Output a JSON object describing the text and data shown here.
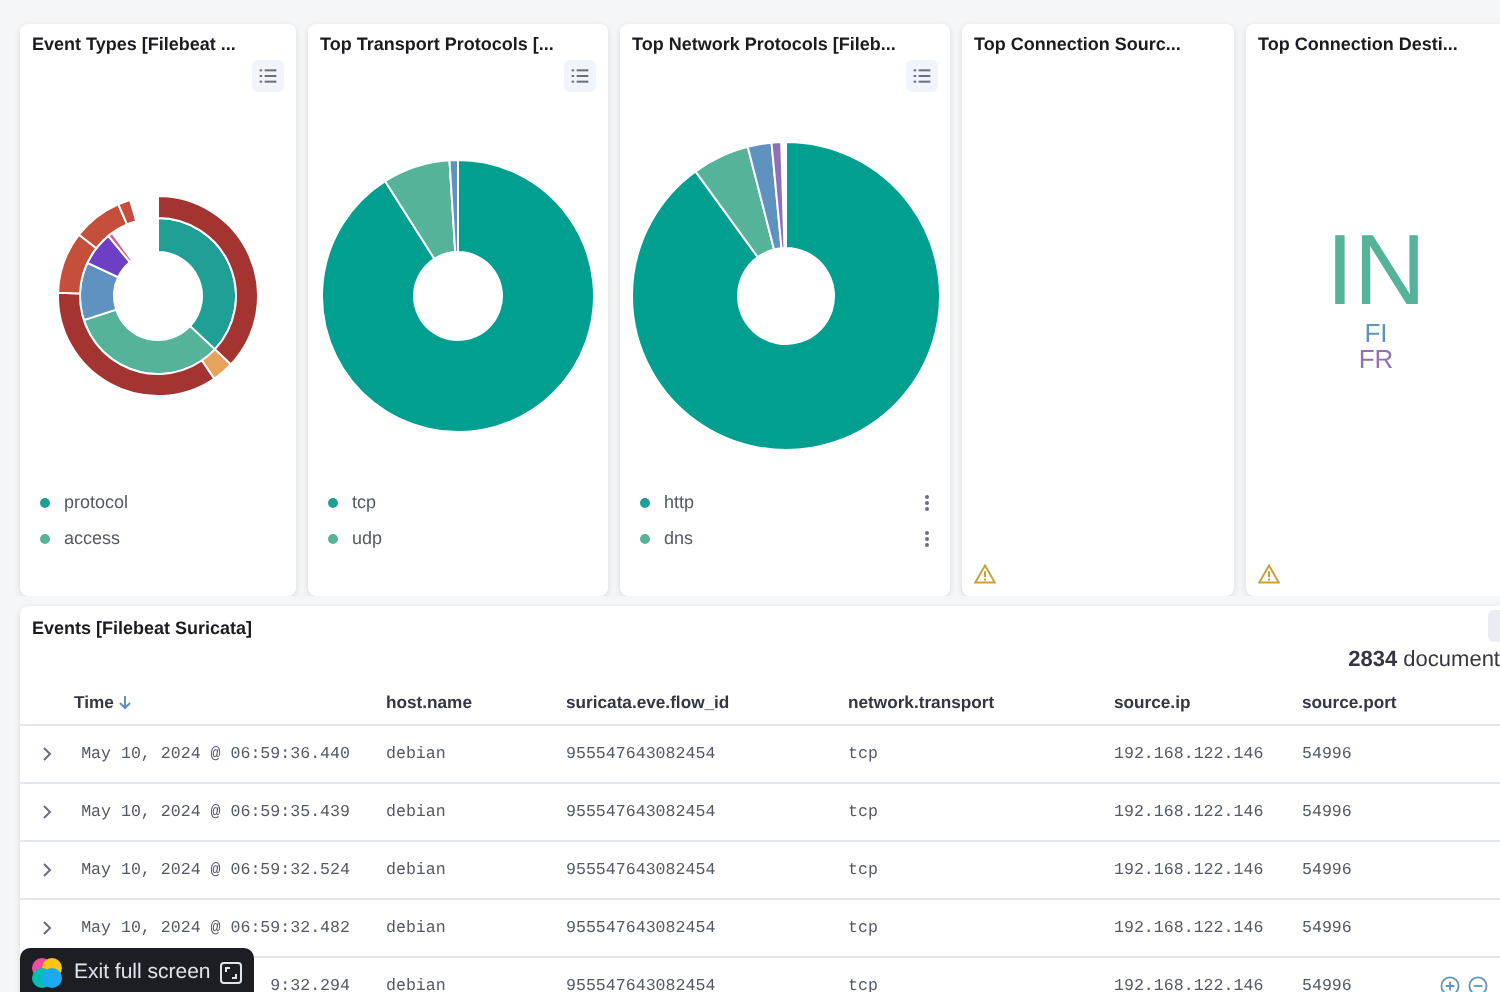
{
  "panels": [
    {
      "kind": "pie",
      "title": "Event Types [Filebeat ...",
      "legend": [
        {
          "label": "protocol",
          "color": "#209f94",
          "menu": false
        },
        {
          "label": "access",
          "color": "#54b399",
          "menu": false
        }
      ]
    },
    {
      "kind": "pie",
      "title": "Top Transport Protocols [...",
      "legend": [
        {
          "label": "tcp",
          "color": "#209f94",
          "menu": false
        },
        {
          "label": "udp",
          "color": "#54b399",
          "menu": false
        }
      ]
    },
    {
      "kind": "pie",
      "title": "Top Network Protocols [Fileb...",
      "legend": [
        {
          "label": "http",
          "color": "#209f94",
          "menu": true
        },
        {
          "label": "dns",
          "color": "#54b399",
          "menu": true
        }
      ]
    },
    {
      "kind": "empty",
      "title": "Top Connection Sourc...",
      "warning": true
    },
    {
      "kind": "tagcloud",
      "title": "Top Connection Desti...",
      "warning": true,
      "tags": [
        {
          "text": "IN",
          "color": "#54b399"
        },
        {
          "text": "FI",
          "color": "#6092c0"
        },
        {
          "text": "FR",
          "color": "#9170b8"
        }
      ]
    }
  ],
  "events": {
    "title": "Events [Filebeat Suricata]",
    "count": "**2834** document",
    "columns": [
      {
        "label": "Time",
        "sorted": true
      },
      {
        "label": "host.name",
        "sorted": false
      },
      {
        "label": "suricata.eve.flow_id",
        "sorted": false
      },
      {
        "label": "network.transport",
        "sorted": false
      },
      {
        "label": "source.ip",
        "sorted": false
      },
      {
        "label": "source.port",
        "sorted": false
      }
    ],
    "rows": [
      {
        "expander": true,
        "hovered": false,
        "cells": [
          "May 10, 2024 @ 06:59:36.440",
          "debian",
          "955547643082454",
          "tcp",
          "192.168.122.146",
          "54996"
        ]
      },
      {
        "expander": true,
        "hovered": false,
        "cells": [
          "May 10, 2024 @ 06:59:35.439",
          "debian",
          "955547643082454",
          "tcp",
          "192.168.122.146",
          "54996"
        ]
      },
      {
        "expander": true,
        "hovered": false,
        "cells": [
          "May 10, 2024 @ 06:59:32.524",
          "debian",
          "955547643082454",
          "tcp",
          "192.168.122.146",
          "54996"
        ]
      },
      {
        "expander": true,
        "hovered": false,
        "cells": [
          "May 10, 2024 @ 06:59:32.482",
          "debian",
          "955547643082454",
          "tcp",
          "192.168.122.146",
          "54996"
        ]
      },
      {
        "expander": false,
        "hovered": true,
        "cells": [
          "9:32.294",
          "debian",
          "955547643082454",
          "tcp",
          "192.168.122.146",
          "54996"
        ]
      }
    ]
  },
  "overlay": {
    "label": "Exit full screen"
  }
}
